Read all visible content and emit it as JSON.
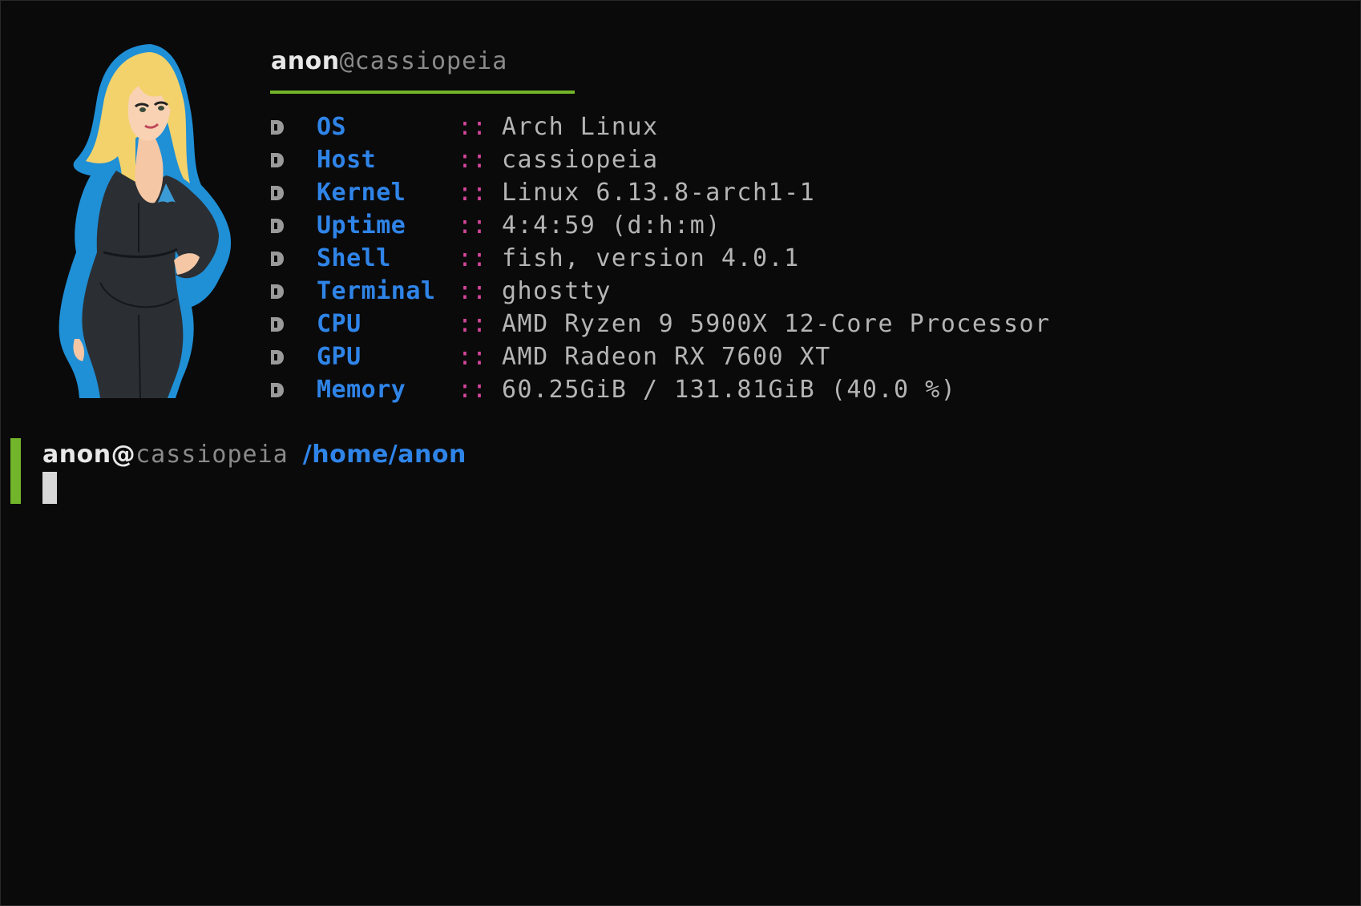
{
  "header": {
    "user": "anon",
    "host": "@cassiopeia"
  },
  "info": [
    {
      "key": "OS",
      "sep": "::",
      "value": "Arch Linux"
    },
    {
      "key": "Host",
      "sep": "::",
      "value": "cassiopeia"
    },
    {
      "key": "Kernel",
      "sep": "::",
      "value": "Linux 6.13.8-arch1-1"
    },
    {
      "key": "Uptime",
      "sep": "::",
      "value": "4:4:59 (d:h:m)"
    },
    {
      "key": "Shell",
      "sep": "::",
      "value": "fish, version 4.0.1"
    },
    {
      "key": "Terminal",
      "sep": "::",
      "value": "ghostty"
    },
    {
      "key": "CPU",
      "sep": "::",
      "value": "AMD Ryzen 9 5900X 12-Core Processor"
    },
    {
      "key": "GPU",
      "sep": "::",
      "value": "AMD Radeon RX 7600 XT"
    },
    {
      "key": "Memory",
      "sep": "::",
      "value": "60.25GiB / 131.81GiB (40.0 %)"
    }
  ],
  "prompt": {
    "user": "anon@",
    "host": "cassiopeia",
    "path": "/home/anon"
  },
  "colors": {
    "background": "#0a0a0a",
    "accent_green": "#72b52a",
    "key_blue": "#2f84e8",
    "separator_pink": "#d4459b",
    "value_gray": "#b5b5b5"
  },
  "icons": {
    "bullet": "disk-bullet-icon",
    "avatar": "anime-girl-arch-hoodie-avatar"
  }
}
